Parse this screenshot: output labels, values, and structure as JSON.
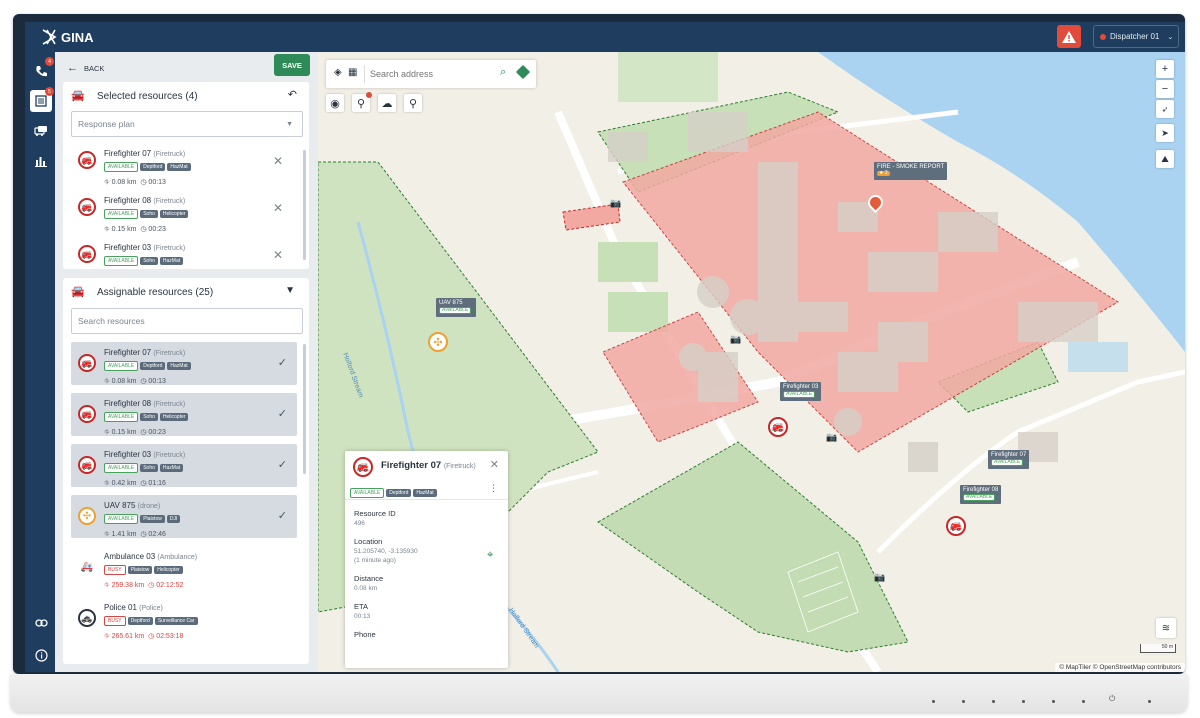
{
  "app": {
    "name": "GINA"
  },
  "header": {
    "dispatcher": "Dispatcher 01"
  },
  "nav": {
    "calls_badge": "4",
    "list_badge": "5"
  },
  "panel": {
    "back": "BACK",
    "save": "SAVE",
    "selected_title": "Selected resources (4)",
    "response_plan_placeholder": "Response plan",
    "selected": [
      {
        "name": "Firefighter 07",
        "type": "(Firetruck)",
        "tags": [
          "AVAILABLE",
          "Deptford",
          "HazMat"
        ],
        "dist": "0.08 km",
        "eta": "00:13"
      },
      {
        "name": "Firefighter 08",
        "type": "(Firetruck)",
        "tags": [
          "AVAILABLE",
          "Soho",
          "Helicopter"
        ],
        "dist": "0.15 km",
        "eta": "00:23"
      },
      {
        "name": "Firefighter 03",
        "type": "(Firetruck)",
        "tags": [
          "AVAILABLE",
          "Soho",
          "HazMat"
        ],
        "dist": "",
        "eta": ""
      }
    ],
    "assignable_title": "Assignable resources (25)",
    "search_placeholder": "Search resources",
    "assignable": [
      {
        "name": "Firefighter 07",
        "type": "(Firetruck)",
        "status": "AVAILABLE",
        "tags": [
          "Deptford",
          "HazMat"
        ],
        "dist": "0.08 km",
        "eta": "00:13"
      },
      {
        "name": "Firefighter 08",
        "type": "(Firetruck)",
        "status": "AVAILABLE",
        "tags": [
          "Soho",
          "Helicopter"
        ],
        "dist": "0.15 km",
        "eta": "00:23"
      },
      {
        "name": "Firefighter 03",
        "type": "(Firetruck)",
        "status": "AVAILABLE",
        "tags": [
          "Soho",
          "HazMat"
        ],
        "dist": "0.42 km",
        "eta": "01:16"
      },
      {
        "name": "UAV 875",
        "type": "(drone)",
        "status": "AVAILABLE",
        "tags": [
          "Plaistow",
          "DJI"
        ],
        "dist": "1.41 km",
        "eta": "02:46"
      },
      {
        "name": "Ambulance 03",
        "type": "(Ambulance)",
        "status": "BUSY",
        "tags": [
          "Plaistow",
          "Helicopter"
        ],
        "dist": "259.38 km",
        "eta": "02:12:52"
      },
      {
        "name": "Police 01",
        "type": "(Police)",
        "status": "BUSY",
        "tags": [
          "Deptford",
          "Surveillance Car"
        ],
        "dist": "265.61 km",
        "eta": "02:53:18"
      }
    ]
  },
  "map": {
    "search_placeholder": "Search address",
    "incident": {
      "title": "FIRE - SMOKE REPORT",
      "count": "2"
    },
    "labels": {
      "uav": {
        "name": "UAV 875",
        "status": "AVAILABLE"
      },
      "ff03": {
        "name": "Firefighter 03",
        "status": "AVAILABLE"
      },
      "ff07": {
        "name": "Firefighter 07",
        "status": "AVAILABLE"
      },
      "ff08": {
        "name": "Firefighter 08",
        "status": "AVAILABLE"
      }
    },
    "water_labels": [
      "Holford Stream",
      "Holford Stream"
    ],
    "scale": "50 m",
    "attribution": "© MapTiler © OpenStreetMap contributors"
  },
  "detail": {
    "name": "Firefighter 07",
    "type": "(Firetruck)",
    "tags": [
      "AVAILABLE",
      "Deptford",
      "HazMat"
    ],
    "resource_id_label": "Resource ID",
    "resource_id": "496",
    "location_label": "Location",
    "location": "51.205740, -3.135930",
    "location_age": "(1 minute ago)",
    "distance_label": "Distance",
    "distance": "0.08 km",
    "eta_label": "ETA",
    "eta": "00:13",
    "phone_label": "Phone"
  }
}
